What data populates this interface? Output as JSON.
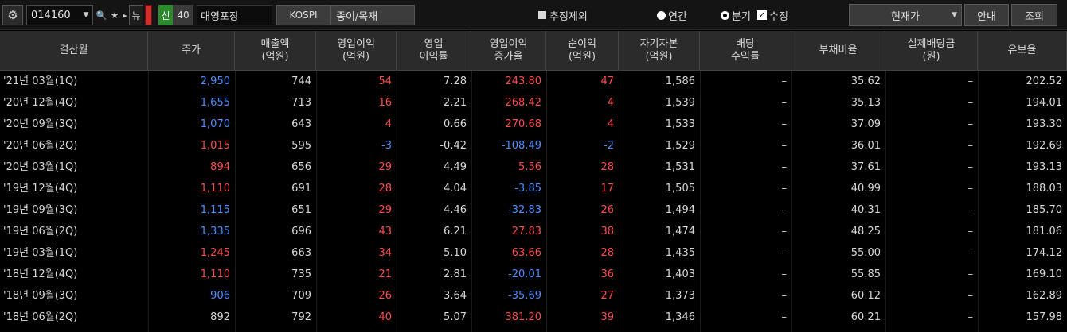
{
  "toolbar": {
    "settings_icon": "gear-icon",
    "code": "014160",
    "code_dropdown": "▼",
    "search_icon": "🔍",
    "star_icon": "★",
    "more_icon": "▸",
    "news_label": "뉴",
    "credit_badge": "신",
    "margin_rate": "40",
    "stock_name": "대영포장",
    "market": "KOSPI",
    "sector": "종이/목재",
    "exclude_estimate": "추정제외",
    "annual": "연간",
    "quarterly": "분기",
    "adjusted": "수정",
    "price_mode": "현재가",
    "guide": "안내",
    "inquiry": "조회"
  },
  "table": {
    "columns": [
      "결산월",
      "주가",
      "매출액\n(억원)",
      "영업이익\n(억원)",
      "영업\n이익률",
      "영업이익\n증가율",
      "순이익\n(억원)",
      "자기자본\n(억원)",
      "배당\n수익률",
      "부채비율",
      "실제배당금\n(원)",
      "유보율"
    ],
    "rows": [
      {
        "period": "'21년 03월(1Q)",
        "price": "2,950",
        "price_dir": "down",
        "sales": "744",
        "op": "54",
        "op_dir": "up",
        "opm": "7.28",
        "opg": "243.80",
        "opg_dir": "up",
        "ni": "47",
        "ni_dir": "up",
        "equity": "1,586",
        "div_yield": "–",
        "debt": "35.62",
        "div": "–",
        "reserve": "202.52"
      },
      {
        "period": "'20년 12월(4Q)",
        "price": "1,655",
        "price_dir": "down",
        "sales": "713",
        "op": "16",
        "op_dir": "up",
        "opm": "2.21",
        "opg": "268.42",
        "opg_dir": "up",
        "ni": "4",
        "ni_dir": "up",
        "equity": "1,539",
        "div_yield": "–",
        "debt": "35.13",
        "div": "–",
        "reserve": "194.01"
      },
      {
        "period": "'20년 09월(3Q)",
        "price": "1,070",
        "price_dir": "down",
        "sales": "643",
        "op": "4",
        "op_dir": "up",
        "opm": "0.66",
        "opg": "270.68",
        "opg_dir": "up",
        "ni": "4",
        "ni_dir": "up",
        "equity": "1,533",
        "div_yield": "–",
        "debt": "37.09",
        "div": "–",
        "reserve": "193.30"
      },
      {
        "period": "'20년 06월(2Q)",
        "price": "1,015",
        "price_dir": "up",
        "sales": "595",
        "op": "-3",
        "op_dir": "down",
        "opm": "-0.42",
        "opg": "-108.49",
        "opg_dir": "down",
        "ni": "-2",
        "ni_dir": "down",
        "equity": "1,529",
        "div_yield": "–",
        "debt": "36.01",
        "div": "–",
        "reserve": "192.69"
      },
      {
        "period": "'20년 03월(1Q)",
        "price": "894",
        "price_dir": "up",
        "sales": "656",
        "op": "29",
        "op_dir": "up",
        "opm": "4.49",
        "opg": "5.56",
        "opg_dir": "up",
        "ni": "28",
        "ni_dir": "up",
        "equity": "1,531",
        "div_yield": "–",
        "debt": "37.61",
        "div": "–",
        "reserve": "193.13"
      },
      {
        "period": "'19년 12월(4Q)",
        "price": "1,110",
        "price_dir": "up",
        "sales": "691",
        "op": "28",
        "op_dir": "up",
        "opm": "4.04",
        "opg": "-3.85",
        "opg_dir": "down",
        "ni": "17",
        "ni_dir": "up",
        "equity": "1,505",
        "div_yield": "–",
        "debt": "40.99",
        "div": "–",
        "reserve": "188.03"
      },
      {
        "period": "'19년 09월(3Q)",
        "price": "1,115",
        "price_dir": "down",
        "sales": "651",
        "op": "29",
        "op_dir": "up",
        "opm": "4.46",
        "opg": "-32.83",
        "opg_dir": "down",
        "ni": "26",
        "ni_dir": "up",
        "equity": "1,494",
        "div_yield": "–",
        "debt": "40.31",
        "div": "–",
        "reserve": "185.70"
      },
      {
        "period": "'19년 06월(2Q)",
        "price": "1,335",
        "price_dir": "down",
        "sales": "696",
        "op": "43",
        "op_dir": "up",
        "opm": "6.21",
        "opg": "27.83",
        "opg_dir": "up",
        "ni": "38",
        "ni_dir": "up",
        "equity": "1,474",
        "div_yield": "–",
        "debt": "48.25",
        "div": "–",
        "reserve": "181.06"
      },
      {
        "period": "'19년 03월(1Q)",
        "price": "1,245",
        "price_dir": "up",
        "sales": "663",
        "op": "34",
        "op_dir": "up",
        "opm": "5.10",
        "opg": "63.66",
        "opg_dir": "up",
        "ni": "28",
        "ni_dir": "up",
        "equity": "1,435",
        "div_yield": "–",
        "debt": "55.00",
        "div": "–",
        "reserve": "174.12"
      },
      {
        "period": "'18년 12월(4Q)",
        "price": "1,110",
        "price_dir": "up",
        "sales": "735",
        "op": "21",
        "op_dir": "up",
        "opm": "2.81",
        "opg": "-20.01",
        "opg_dir": "down",
        "ni": "36",
        "ni_dir": "up",
        "equity": "1,403",
        "div_yield": "–",
        "debt": "55.85",
        "div": "–",
        "reserve": "169.10"
      },
      {
        "period": "'18년 09월(3Q)",
        "price": "906",
        "price_dir": "down",
        "sales": "709",
        "op": "26",
        "op_dir": "up",
        "opm": "3.64",
        "opg": "-35.69",
        "opg_dir": "down",
        "ni": "27",
        "ni_dir": "up",
        "equity": "1,373",
        "div_yield": "–",
        "debt": "60.12",
        "div": "–",
        "reserve": "162.89"
      },
      {
        "period": "'18년 06월(2Q)",
        "price": "892",
        "price_dir": "none",
        "sales": "792",
        "op": "40",
        "op_dir": "up",
        "opm": "5.07",
        "opg": "381.20",
        "opg_dir": "up",
        "ni": "39",
        "ni_dir": "up",
        "equity": "1,346",
        "div_yield": "–",
        "debt": "60.21",
        "div": "–",
        "reserve": "157.98"
      }
    ]
  },
  "colors": {
    "up": "#ff4b4b",
    "down": "#4d8eff",
    "header_bg": "#2b2b2b",
    "background": "#000000",
    "credit_badge": "#2c8a2c"
  }
}
